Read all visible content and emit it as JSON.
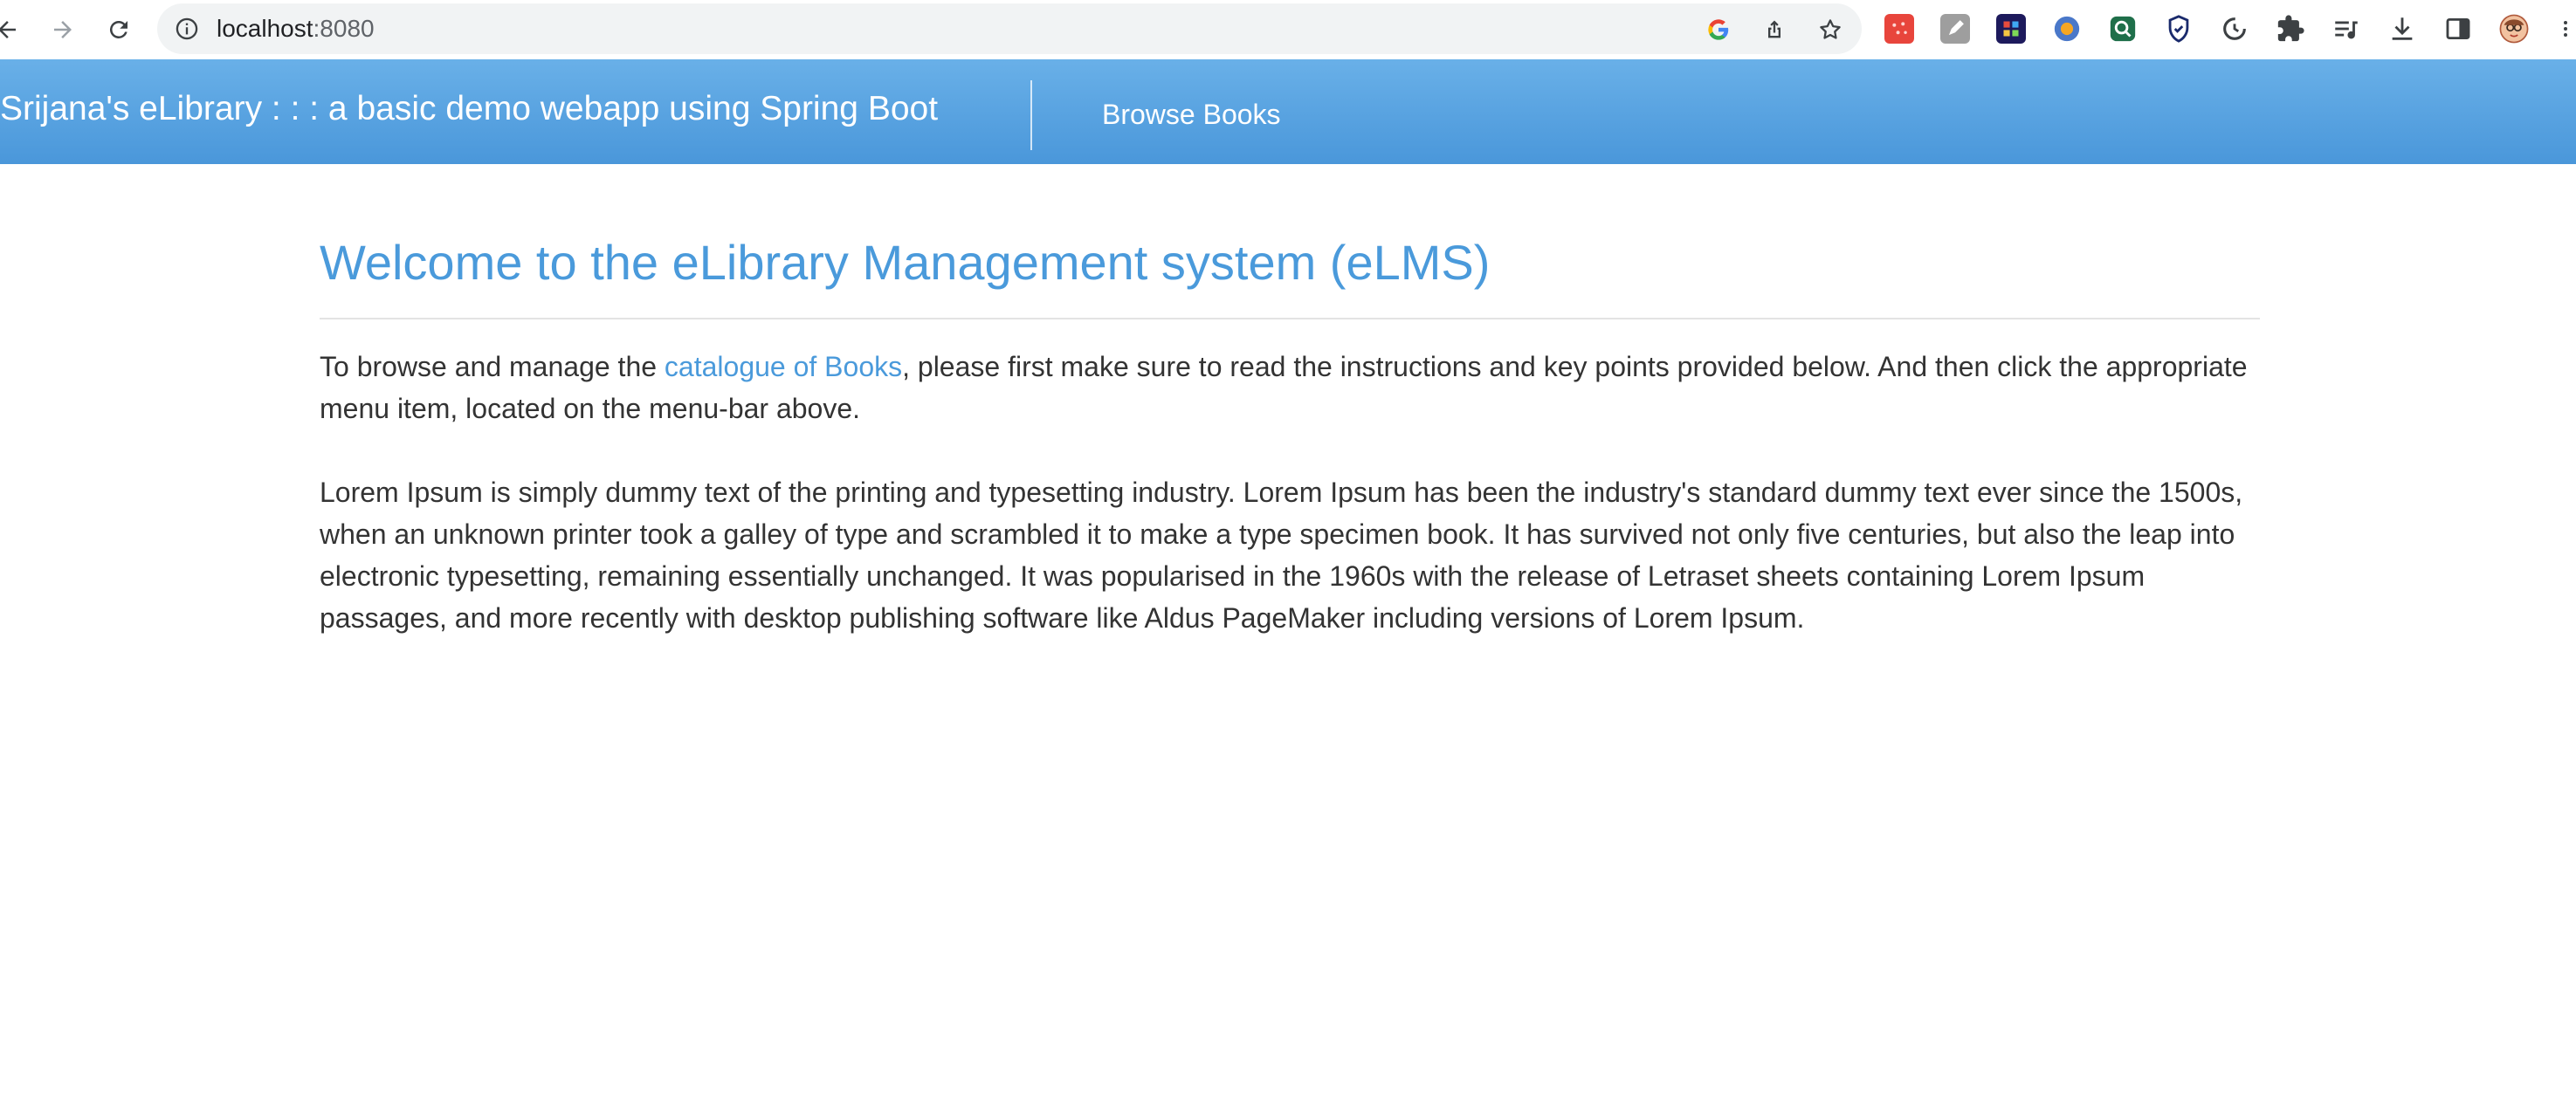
{
  "browser": {
    "url_host": "localhost",
    "url_port": ":8080",
    "icons": [
      "back-arrow-icon",
      "forward-arrow-icon",
      "reload-icon",
      "info-icon",
      "google-icon",
      "share-icon",
      "bookmark-star-icon",
      "extensions-puzzle-icon",
      "reading-list-icon",
      "download-icon",
      "side-panel-icon",
      "profile-avatar-icon"
    ]
  },
  "navbar": {
    "brand": "Srijana's eLibrary : : : a basic demo webapp using Spring Boot",
    "link_browse": "Browse Books",
    "colors": {
      "top": "#69b0e8",
      "bottom": "#4a97da"
    }
  },
  "main": {
    "title": "Welcome to the eLibrary Management system (eLMS)",
    "p1_before": "To browse and manage the ",
    "p1_link": "catalogue of Books",
    "p1_after": ", please first make sure to read the instructions and key points provided below. And then click the appropriate menu item, located on the menu-bar above.",
    "p2": "Lorem Ipsum is simply dummy text of the printing and typesetting industry. Lorem Ipsum has been the industry's standard dummy text ever since the 1500s, when an unknown printer took a galley of type and scrambled it to make a type specimen book. It has survived not only five centuries, but also the leap into electronic typesetting, remaining essentially unchanged. It was popularised in the 1960s with the release of Letraset sheets containing Lorem Ipsum passages, and more recently with desktop publishing software like Aldus PageMaker including versions of Lorem Ipsum.",
    "colors": {
      "title": "#4a9adb",
      "link": "#4a9adb",
      "text": "#333333"
    }
  }
}
